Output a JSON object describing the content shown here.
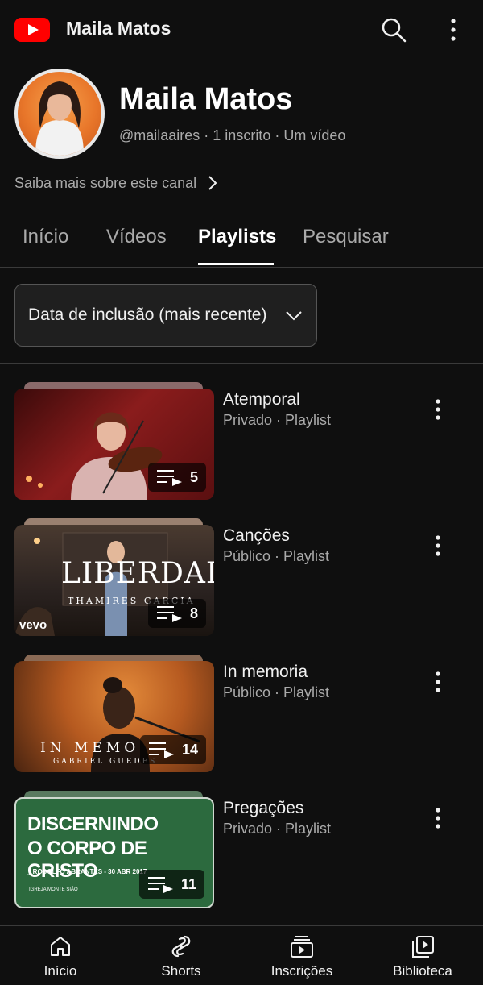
{
  "app": {
    "title": "Maila Matos"
  },
  "channel": {
    "name": "Maila Matos",
    "meta": "@mailaaires · 1 inscrito · Um vídeo",
    "about_link": "Saiba mais sobre este canal"
  },
  "tabs": [
    {
      "label": "Início"
    },
    {
      "label": "Vídeos"
    },
    {
      "label": "Playlists",
      "active": true
    },
    {
      "label": "Pesquisar"
    }
  ],
  "sort": {
    "label": "Data de inclusão (mais recente)"
  },
  "playlists": [
    {
      "title": "Atemporal",
      "subtitle": "Privado · Playlist",
      "count": "5",
      "thumb_color": "#7a1a1a"
    },
    {
      "title": "Canções",
      "subtitle": "Público · Playlist",
      "count": "8",
      "thumb_text": "LIBERDADE",
      "thumb_subtext": "THAMIRES GARCIA",
      "thumb_logo": "vevo"
    },
    {
      "title": "In memoria",
      "subtitle": "Público · Playlist",
      "count": "14",
      "thumb_text": "IN MEMO",
      "thumb_subtext": "GABRIEL GUEDES"
    },
    {
      "title": "Pregações",
      "subtitle": "Privado · Playlist",
      "count": "11",
      "thumb_text_1": "DISCERNINDO",
      "thumb_text_2": "O CORPO DE CRISTO",
      "thumb_subtext": "_ RODOLFO ABRANTES - 30 ABR 2017",
      "thumb_logo": "IGREJA MONTE SIÃO"
    }
  ],
  "bottom_nav": [
    {
      "label": "Início",
      "icon": "home-icon"
    },
    {
      "label": "Shorts",
      "icon": "shorts-icon"
    },
    {
      "label": "Inscrições",
      "icon": "subscriptions-icon"
    },
    {
      "label": "Biblioteca",
      "icon": "library-icon"
    }
  ],
  "colors": {
    "background": "#0f0f0f",
    "brand_red": "#ff0000",
    "secondary_text": "#aaaaaa"
  }
}
